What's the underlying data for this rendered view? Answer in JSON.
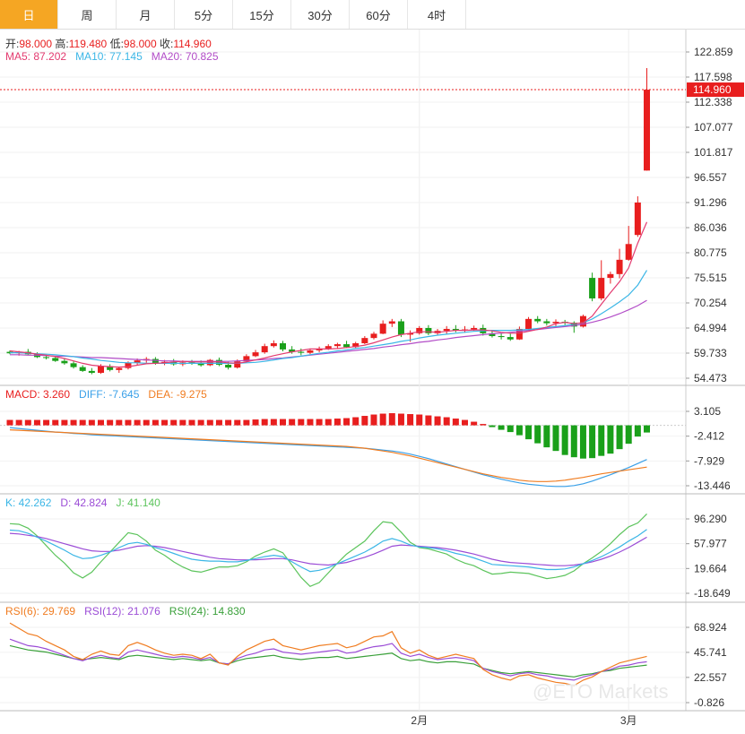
{
  "tabs": [
    "日",
    "周",
    "月",
    "5分",
    "15分",
    "30分",
    "60分",
    "4时"
  ],
  "active_tab": 0,
  "colors": {
    "up": "#e81e1e",
    "down": "#1aa01a",
    "ma5": "#e33a6f",
    "ma10": "#3bb6e6",
    "ma20": "#b24cc7",
    "diff": "#3aa0e8",
    "dea": "#f07c20",
    "k": "#3bb6e6",
    "d": "#9b4cd6",
    "j": "#5cc45c",
    "rsi6": "#f07c20",
    "rsi12": "#9b4cd6",
    "rsi24": "#3aa03a"
  },
  "ohlc_info": {
    "open_label": "开:",
    "open": "98.000",
    "high_label": "高:",
    "high": "119.480",
    "low_label": "低:",
    "low": "98.000",
    "close_label": "收:",
    "close": "114.960"
  },
  "ma_info": {
    "ma5": "MA5: 87.202",
    "ma10": "MA10: 77.145",
    "ma20": "MA20: 70.825"
  },
  "macd_info": {
    "macd": "MACD: 3.260",
    "diff": "DIFF: -7.645",
    "dea": "DEA: -9.275"
  },
  "kdj_info": {
    "k": "K: 42.262",
    "d": "D: 42.824",
    "j": "J: 41.140"
  },
  "rsi_info": {
    "rsi6": "RSI(6): 29.769",
    "rsi12": "RSI(12): 21.076",
    "rsi24": "RSI(24): 14.830"
  },
  "price_tag": "114.960",
  "watermark": "@ETO Markets",
  "chart_data": [
    {
      "type": "candlestick",
      "ylim": [
        52.0,
        124.0
      ],
      "yticks": [
        "122.859",
        "117.598",
        "112.338",
        "107.077",
        "101.817",
        "96.557",
        "91.296",
        "86.036",
        "80.775",
        "75.515",
        "70.254",
        "64.994",
        "59.733",
        "54.473"
      ],
      "xlabels": [
        {
          "label": "2月",
          "index": 45
        },
        {
          "label": "3月",
          "index": 68
        }
      ],
      "candles": [
        [
          60.0,
          60.3,
          59.5,
          59.7
        ],
        [
          59.7,
          60.2,
          59.2,
          60.0
        ],
        [
          60.0,
          60.6,
          59.4,
          59.5
        ],
        [
          59.5,
          59.9,
          58.7,
          58.9
        ],
        [
          58.9,
          59.4,
          58.4,
          58.7
        ],
        [
          58.7,
          59.1,
          57.9,
          58.1
        ],
        [
          58.1,
          58.6,
          57.3,
          57.6
        ],
        [
          57.6,
          58.0,
          56.5,
          56.8
        ],
        [
          56.8,
          57.2,
          55.8,
          56.0
        ],
        [
          56.0,
          56.6,
          55.3,
          55.6
        ],
        [
          55.6,
          57.4,
          55.4,
          57.0
        ],
        [
          57.0,
          57.4,
          55.9,
          56.2
        ],
        [
          56.2,
          56.9,
          55.6,
          56.6
        ],
        [
          56.6,
          58.0,
          56.3,
          57.7
        ],
        [
          57.7,
          58.6,
          57.2,
          58.2
        ],
        [
          58.2,
          58.9,
          57.7,
          58.5
        ],
        [
          58.5,
          58.9,
          57.3,
          57.6
        ],
        [
          57.6,
          58.3,
          57.2,
          57.9
        ],
        [
          57.9,
          58.5,
          57.1,
          57.4
        ],
        [
          57.4,
          58.2,
          57.0,
          57.8
        ],
        [
          57.8,
          58.3,
          57.3,
          57.5
        ],
        [
          57.5,
          58.2,
          56.9,
          57.2
        ],
        [
          57.2,
          58.5,
          57.0,
          58.3
        ],
        [
          58.3,
          58.8,
          57.0,
          57.3
        ],
        [
          57.3,
          57.9,
          56.3,
          56.7
        ],
        [
          56.7,
          58.4,
          56.5,
          58.0
        ],
        [
          58.0,
          59.5,
          57.8,
          59.1
        ],
        [
          59.1,
          60.4,
          58.9,
          59.9
        ],
        [
          59.9,
          61.7,
          59.6,
          61.2
        ],
        [
          61.2,
          62.4,
          60.9,
          61.8
        ],
        [
          61.8,
          62.3,
          60.1,
          60.5
        ],
        [
          60.5,
          61.2,
          59.6,
          60.0
        ],
        [
          60.0,
          60.7,
          59.3,
          59.8
        ],
        [
          59.8,
          60.7,
          59.5,
          60.3
        ],
        [
          60.3,
          61.1,
          59.9,
          60.7
        ],
        [
          60.7,
          61.6,
          60.4,
          61.2
        ],
        [
          61.2,
          61.9,
          60.6,
          61.6
        ],
        [
          61.6,
          62.3,
          60.8,
          61.0
        ],
        [
          61.0,
          62.1,
          60.8,
          61.8
        ],
        [
          61.8,
          63.3,
          61.6,
          62.9
        ],
        [
          62.9,
          64.2,
          62.6,
          63.8
        ],
        [
          63.8,
          66.6,
          63.7,
          65.9
        ],
        [
          65.9,
          66.9,
          65.2,
          66.4
        ],
        [
          66.4,
          66.9,
          63.1,
          63.6
        ],
        [
          63.6,
          64.5,
          62.1,
          63.9
        ],
        [
          63.9,
          65.4,
          63.6,
          65.0
        ],
        [
          65.0,
          65.6,
          63.5,
          63.9
        ],
        [
          63.9,
          64.8,
          63.4,
          64.4
        ],
        [
          64.4,
          65.4,
          63.7,
          64.8
        ],
        [
          64.8,
          65.6,
          64.1,
          64.5
        ],
        [
          64.5,
          65.4,
          64.0,
          64.7
        ],
        [
          64.7,
          65.5,
          64.4,
          65.0
        ],
        [
          65.0,
          65.7,
          63.4,
          63.9
        ],
        [
          63.9,
          64.5,
          63.0,
          63.3
        ],
        [
          63.3,
          63.9,
          62.6,
          63.1
        ],
        [
          63.1,
          63.8,
          62.3,
          62.6
        ],
        [
          62.6,
          65.3,
          62.5,
          64.8
        ],
        [
          64.8,
          67.3,
          64.6,
          66.9
        ],
        [
          66.9,
          67.5,
          66.0,
          66.4
        ],
        [
          66.4,
          66.9,
          65.5,
          66.0
        ],
        [
          66.0,
          66.8,
          65.4,
          66.3
        ],
        [
          66.3,
          66.7,
          65.6,
          66.1
        ],
        [
          66.1,
          66.4,
          64.0,
          65.3
        ],
        [
          65.3,
          67.8,
          65.1,
          67.5
        ],
        [
          75.5,
          76.6,
          70.6,
          71.2
        ],
        [
          71.2,
          79.2,
          70.8,
          75.5
        ],
        [
          75.5,
          76.8,
          74.3,
          76.3
        ],
        [
          76.3,
          81.6,
          75.4,
          79.3
        ],
        [
          79.3,
          86.4,
          79.1,
          82.6
        ],
        [
          84.5,
          92.6,
          84.1,
          91.3
        ],
        [
          98.0,
          119.48,
          98.0,
          114.96
        ]
      ],
      "ma5": [
        60.2,
        60.0,
        59.8,
        59.5,
        59.3,
        59.0,
        58.6,
        58.1,
        57.6,
        57.2,
        57.0,
        56.9,
        56.8,
        56.9,
        57.2,
        57.5,
        57.6,
        57.7,
        57.9,
        58.0,
        57.9,
        57.9,
        57.9,
        57.9,
        57.7,
        57.6,
        57.9,
        58.3,
        58.7,
        59.2,
        59.6,
        60.0,
        60.3,
        60.6,
        60.6,
        60.6,
        60.7,
        60.9,
        61.1,
        61.4,
        61.9,
        62.5,
        63.1,
        63.6,
        63.9,
        64.2,
        64.2,
        64.1,
        64.3,
        64.5,
        64.5,
        64.6,
        64.6,
        64.4,
        64.1,
        63.9,
        63.9,
        64.3,
        64.7,
        65.2,
        65.9,
        66.2,
        65.9,
        66.1,
        67.5,
        70.0,
        72.4,
        74.7,
        77.6,
        82.8,
        87.2
      ],
      "ma10": [
        59.8,
        59.8,
        59.7,
        59.6,
        59.5,
        59.4,
        59.2,
        59.0,
        58.7,
        58.5,
        58.2,
        58.0,
        57.8,
        57.7,
        57.7,
        57.6,
        57.6,
        57.6,
        57.6,
        57.6,
        57.6,
        57.6,
        57.6,
        57.6,
        57.6,
        57.6,
        57.7,
        57.8,
        58.0,
        58.3,
        58.6,
        58.8,
        59.1,
        59.4,
        59.7,
        59.9,
        60.2,
        60.4,
        60.7,
        60.9,
        61.2,
        61.5,
        61.8,
        62.2,
        62.5,
        62.9,
        63.2,
        63.5,
        63.7,
        63.9,
        64.1,
        64.3,
        64.4,
        64.5,
        64.5,
        64.5,
        64.6,
        64.7,
        64.9,
        65.1,
        65.3,
        65.5,
        65.8,
        66.1,
        66.9,
        68.0,
        69.2,
        70.5,
        71.9,
        74.0,
        77.1
      ],
      "ma20": [
        59.4,
        59.4,
        59.3,
        59.3,
        59.2,
        59.1,
        59.1,
        59.0,
        58.9,
        58.8,
        58.8,
        58.7,
        58.6,
        58.5,
        58.4,
        58.3,
        58.2,
        58.1,
        58.1,
        58.0,
        58.0,
        58.0,
        58.0,
        58.0,
        58.0,
        58.1,
        58.2,
        58.3,
        58.4,
        58.6,
        58.7,
        58.9,
        59.1,
        59.3,
        59.5,
        59.7,
        59.9,
        60.1,
        60.3,
        60.5,
        60.7,
        61.0,
        61.2,
        61.5,
        61.7,
        62.0,
        62.2,
        62.5,
        62.7,
        63.0,
        63.2,
        63.4,
        63.6,
        63.8,
        63.9,
        64.1,
        64.3,
        64.5,
        64.7,
        64.9,
        65.1,
        65.3,
        65.5,
        65.8,
        66.2,
        66.7,
        67.3,
        68.0,
        68.8,
        69.7,
        70.8
      ]
    },
    {
      "type": "macd",
      "ylim": [
        -14.5,
        4.5
      ],
      "yticks": [
        "3.105",
        "-2.412",
        "-7.929",
        "-13.446"
      ],
      "hist": [
        1.2,
        1.2,
        1.2,
        1.2,
        1.2,
        1.2,
        1.2,
        1.2,
        1.2,
        1.2,
        1.2,
        1.2,
        1.2,
        1.2,
        1.2,
        1.2,
        1.2,
        1.2,
        1.2,
        1.2,
        1.2,
        1.2,
        1.2,
        1.2,
        1.2,
        1.2,
        1.2,
        1.3,
        1.4,
        1.4,
        1.4,
        1.4,
        1.4,
        1.4,
        1.4,
        1.4,
        1.5,
        1.6,
        1.8,
        2.1,
        2.4,
        2.6,
        2.7,
        2.6,
        2.5,
        2.4,
        2.2,
        2.0,
        1.8,
        1.5,
        1.2,
        0.8,
        0.3,
        -0.4,
        -1.0,
        -1.5,
        -2.2,
        -3.1,
        -4.0,
        -4.9,
        -5.7,
        -6.6,
        -7.1,
        -7.4,
        -7.3,
        -6.8,
        -6.3,
        -5.3,
        -4.1,
        -2.5,
        -1.6
      ],
      "diff": [
        -0.5,
        -0.7,
        -0.9,
        -1.1,
        -1.3,
        -1.5,
        -1.6,
        -1.8,
        -1.9,
        -2.1,
        -2.2,
        -2.3,
        -2.4,
        -2.5,
        -2.6,
        -2.7,
        -2.8,
        -2.9,
        -3.0,
        -3.1,
        -3.2,
        -3.3,
        -3.4,
        -3.5,
        -3.6,
        -3.7,
        -3.8,
        -3.9,
        -4.0,
        -4.1,
        -4.2,
        -4.3,
        -4.4,
        -4.5,
        -4.6,
        -4.7,
        -4.8,
        -4.9,
        -5.0,
        -5.1,
        -5.3,
        -5.5,
        -5.7,
        -6.0,
        -6.4,
        -6.9,
        -7.4,
        -8.0,
        -8.6,
        -9.2,
        -9.8,
        -10.4,
        -11.0,
        -11.5,
        -12.0,
        -12.4,
        -12.8,
        -13.1,
        -13.3,
        -13.5,
        -13.6,
        -13.6,
        -13.4,
        -13.0,
        -12.4,
        -11.7,
        -11.0,
        -10.2,
        -9.4,
        -8.5,
        -7.6
      ],
      "dea": [
        -1.0,
        -1.1,
        -1.2,
        -1.3,
        -1.4,
        -1.5,
        -1.6,
        -1.7,
        -1.8,
        -1.9,
        -2.0,
        -2.1,
        -2.2,
        -2.3,
        -2.4,
        -2.5,
        -2.6,
        -2.7,
        -2.8,
        -2.9,
        -3.0,
        -3.1,
        -3.2,
        -3.3,
        -3.4,
        -3.5,
        -3.6,
        -3.7,
        -3.8,
        -3.9,
        -4.0,
        -4.1,
        -4.2,
        -4.3,
        -4.4,
        -4.5,
        -4.6,
        -4.7,
        -4.9,
        -5.1,
        -5.4,
        -5.7,
        -6.0,
        -6.4,
        -6.8,
        -7.3,
        -7.8,
        -8.3,
        -8.8,
        -9.3,
        -9.8,
        -10.3,
        -10.8,
        -11.2,
        -11.6,
        -11.9,
        -12.2,
        -12.4,
        -12.5,
        -12.5,
        -12.4,
        -12.2,
        -11.9,
        -11.6,
        -11.2,
        -10.8,
        -10.5,
        -10.2,
        -9.9,
        -9.6,
        -9.3
      ]
    },
    {
      "type": "kdj",
      "ylim": [
        -22,
        104
      ],
      "yticks": [
        "96.290",
        "57.977",
        "19.664",
        "-18.649"
      ],
      "k": [
        79,
        78,
        74,
        68,
        62,
        55,
        48,
        40,
        35,
        36,
        40,
        45,
        52,
        58,
        60,
        57,
        52,
        48,
        43,
        38,
        34,
        32,
        31,
        31,
        30,
        30,
        32,
        35,
        38,
        40,
        38,
        30,
        22,
        15,
        17,
        21,
        27,
        33,
        39,
        45,
        53,
        62,
        66,
        62,
        56,
        53,
        52,
        50,
        47,
        43,
        40,
        36,
        31,
        26,
        25,
        24,
        23,
        22,
        20,
        18,
        18,
        19,
        22,
        27,
        32,
        38,
        45,
        53,
        62,
        70,
        80
      ],
      "d": [
        74,
        73,
        71,
        69,
        66,
        62,
        58,
        54,
        50,
        47,
        46,
        46,
        48,
        51,
        54,
        55,
        54,
        52,
        49,
        46,
        43,
        40,
        37,
        35,
        34,
        33,
        33,
        33,
        34,
        35,
        35,
        33,
        30,
        27,
        26,
        25,
        27,
        29,
        33,
        37,
        42,
        48,
        54,
        56,
        55,
        54,
        53,
        52,
        50,
        48,
        45,
        42,
        38,
        34,
        31,
        29,
        28,
        27,
        26,
        25,
        24,
        24,
        25,
        27,
        30,
        34,
        39,
        45,
        52,
        60,
        68
      ],
      "j": [
        89,
        88,
        82,
        70,
        55,
        40,
        28,
        13,
        5,
        14,
        30,
        45,
        60,
        75,
        72,
        62,
        48,
        40,
        30,
        22,
        16,
        14,
        18,
        22,
        22,
        24,
        30,
        39,
        45,
        50,
        44,
        25,
        6,
        -8,
        -2,
        13,
        28,
        42,
        52,
        62,
        78,
        92,
        90,
        76,
        60,
        52,
        50,
        46,
        42,
        34,
        28,
        24,
        17,
        11,
        12,
        14,
        13,
        12,
        8,
        4,
        6,
        9,
        16,
        27,
        36,
        46,
        58,
        72,
        84,
        90,
        104
      ]
    },
    {
      "type": "rsi",
      "ylim": [
        -5,
        84
      ],
      "yticks": [
        "68.924",
        "45.741",
        "22.557",
        "-0.826"
      ],
      "rsi6": [
        73,
        68,
        63,
        61,
        56,
        52,
        48,
        42,
        39,
        44,
        47,
        44,
        43,
        52,
        55,
        52,
        48,
        45,
        43,
        44,
        43,
        40,
        44,
        36,
        34,
        42,
        48,
        52,
        56,
        58,
        52,
        50,
        48,
        50,
        52,
        53,
        54,
        50,
        52,
        56,
        60,
        61,
        65,
        50,
        45,
        48,
        43,
        40,
        42,
        44,
        42,
        40,
        30,
        25,
        22,
        20,
        24,
        25,
        22,
        20,
        18,
        17,
        15,
        20,
        23,
        28,
        32,
        36,
        38,
        40,
        42
      ],
      "rsi12": [
        58,
        55,
        52,
        51,
        49,
        46,
        43,
        40,
        38,
        41,
        43,
        41,
        40,
        46,
        48,
        46,
        44,
        42,
        41,
        42,
        41,
        39,
        41,
        36,
        35,
        40,
        43,
        45,
        48,
        49,
        46,
        45,
        44,
        45,
        46,
        47,
        48,
        45,
        46,
        49,
        51,
        52,
        54,
        45,
        42,
        44,
        41,
        39,
        40,
        41,
        40,
        38,
        31,
        28,
        26,
        24,
        26,
        27,
        25,
        24,
        22,
        21,
        20,
        23,
        25,
        28,
        30,
        33,
        34,
        36,
        37
      ],
      "rsi24": [
        52,
        50,
        48,
        47,
        46,
        44,
        42,
        40,
        39,
        40,
        41,
        40,
        39,
        42,
        43,
        42,
        41,
        40,
        39,
        40,
        39,
        38,
        39,
        36,
        35,
        38,
        40,
        41,
        42,
        43,
        41,
        40,
        39,
        40,
        41,
        41,
        42,
        40,
        41,
        42,
        43,
        44,
        45,
        40,
        38,
        39,
        37,
        36,
        37,
        37,
        36,
        35,
        31,
        29,
        27,
        26,
        27,
        28,
        27,
        26,
        25,
        24,
        23,
        25,
        26,
        28,
        29,
        31,
        32,
        33,
        34
      ]
    }
  ]
}
